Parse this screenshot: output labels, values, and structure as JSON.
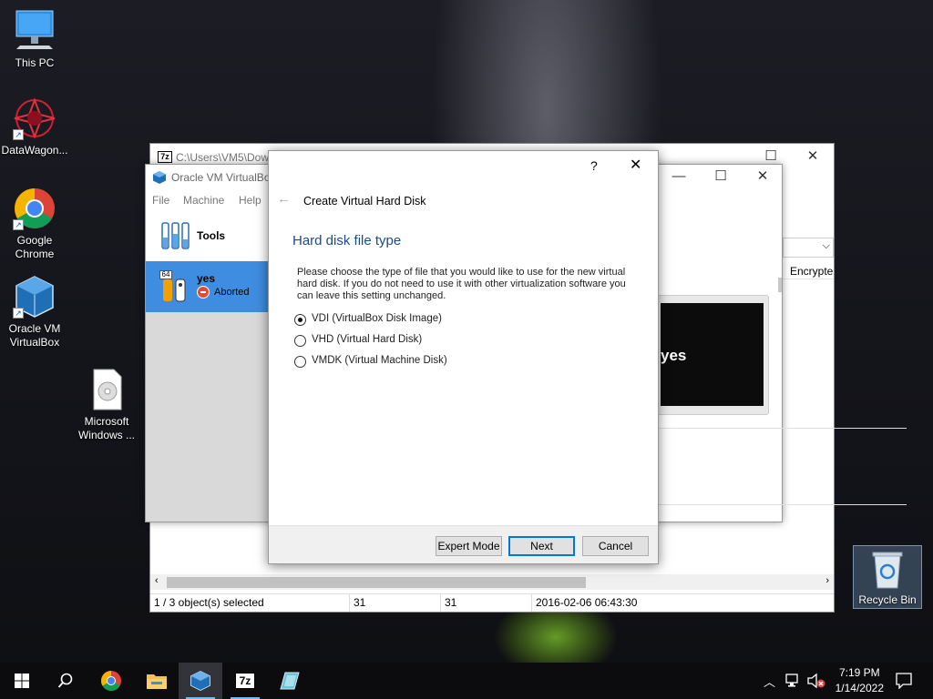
{
  "desktop": {
    "icons": [
      {
        "label": "This PC"
      },
      {
        "label": "DataWagon..."
      },
      {
        "label": "Google Chrome"
      },
      {
        "label": "Oracle VM VirtualBox"
      },
      {
        "label": "Microsoft Windows ..."
      },
      {
        "label": "Recycle Bin"
      }
    ]
  },
  "sevenzip": {
    "title": "C:\\Users\\VM5\\Dow",
    "column_header_right": "Encrypte",
    "status": {
      "selected": "1 / 3 object(s) selected",
      "size": "31",
      "packed": "31",
      "modified": "2016-02-06 06:43:30"
    }
  },
  "virtualbox": {
    "title": "Oracle VM VirtualBox",
    "menu": [
      "File",
      "Machine",
      "Help"
    ],
    "tools_label": "Tools",
    "vm": {
      "name": "yes",
      "state": "Aborted",
      "badge": "64"
    },
    "preview_text": "yes"
  },
  "dialog": {
    "help": "?",
    "back_arrow": "←",
    "title": "Create Virtual Hard Disk",
    "heading": "Hard disk file type",
    "description": "Please choose the type of file that you would like to use for the new virtual hard disk. If you do not need to use it with other virtualization software you can leave this setting unchanged.",
    "options": [
      {
        "label": "VDI (VirtualBox Disk Image)",
        "selected": true
      },
      {
        "label": "VHD (Virtual Hard Disk)",
        "selected": false
      },
      {
        "label": "VMDK (Virtual Machine Disk)",
        "selected": false
      }
    ],
    "buttons": {
      "expert": "Expert Mode",
      "next": "Next",
      "cancel": "Cancel"
    }
  },
  "taskbar": {
    "time": "7:19 PM",
    "date": "1/14/2022",
    "pinned": [
      "start-icon",
      "search-icon",
      "chrome-icon",
      "file-explorer-icon",
      "virtualbox-icon",
      "7zip-icon",
      "app-icon"
    ],
    "sevenzip_label": "7z"
  },
  "colors": {
    "accent": "#0078d7",
    "vm_selected": "#3e8de0",
    "heading": "#1a4b8c"
  }
}
